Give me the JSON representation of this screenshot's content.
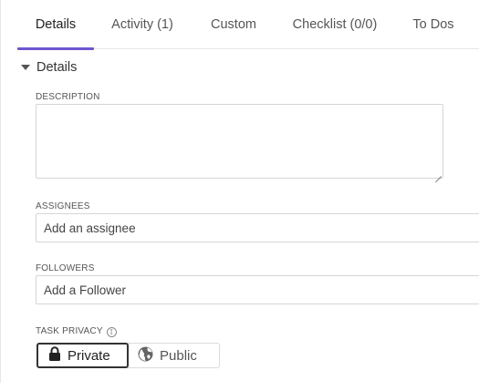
{
  "tabs": [
    {
      "label": "Details",
      "active": true
    },
    {
      "label": "Activity (1)",
      "active": false
    },
    {
      "label": "Custom",
      "active": false
    },
    {
      "label": "Checklist (0/0)",
      "active": false
    },
    {
      "label": "To Dos",
      "active": false
    }
  ],
  "section": {
    "title": "Details",
    "icon": "caret-down-icon"
  },
  "description": {
    "label": "DESCRIPTION",
    "value": ""
  },
  "assignees": {
    "label": "ASSIGNEES",
    "placeholder": "Add an assignee"
  },
  "followers": {
    "label": "FOLLOWERS",
    "placeholder": "Add a Follower"
  },
  "privacy": {
    "label": "TASK PRIVACY",
    "info_icon": "info-icon",
    "options": [
      {
        "label": "Private",
        "icon": "lock-icon",
        "selected": true
      },
      {
        "label": "Public",
        "icon": "globe-icon",
        "selected": false
      }
    ]
  },
  "colors": {
    "accent": "#6e56cf",
    "border": "#d6d6d6",
    "text": "#333333"
  }
}
